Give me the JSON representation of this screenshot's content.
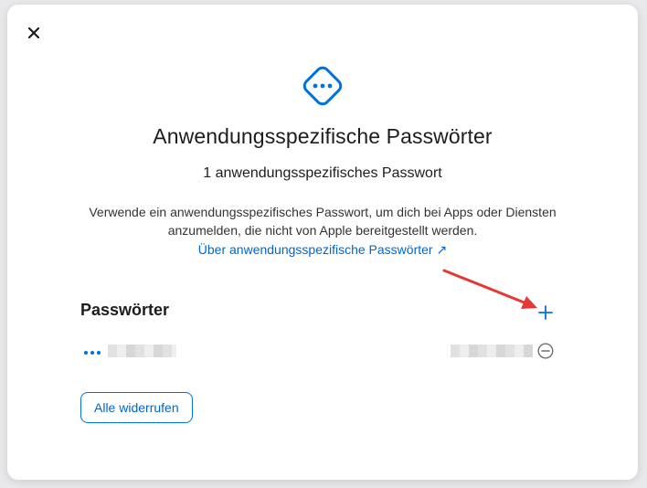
{
  "modal": {
    "title": "Anwendungsspezifische Passwörter",
    "subtitle": "1 anwendungsspezifisches Passwort",
    "description": "Verwende ein anwendungsspezifisches Passwort, um dich bei Apps oder Diensten anzumelden, die nicht von Apple bereitgestellt werden.",
    "learn_more_link": "Über anwendungsspezifische Passwörter ↗",
    "header_icon": "dots-diamond-icon",
    "close_icon": "close-icon"
  },
  "passwords": {
    "section_title": "Passwörter",
    "add_icon": "plus-icon",
    "items": [
      {
        "more_icon": "ellipsis-icon",
        "name": "",
        "date": "",
        "remove_icon": "minus-circle-icon"
      }
    ]
  },
  "actions": {
    "revoke_all_label": "Alle widerrufen"
  },
  "colors": {
    "accent": "#0071e3",
    "link": "#0066cc",
    "annotation_arrow": "#e53935"
  }
}
